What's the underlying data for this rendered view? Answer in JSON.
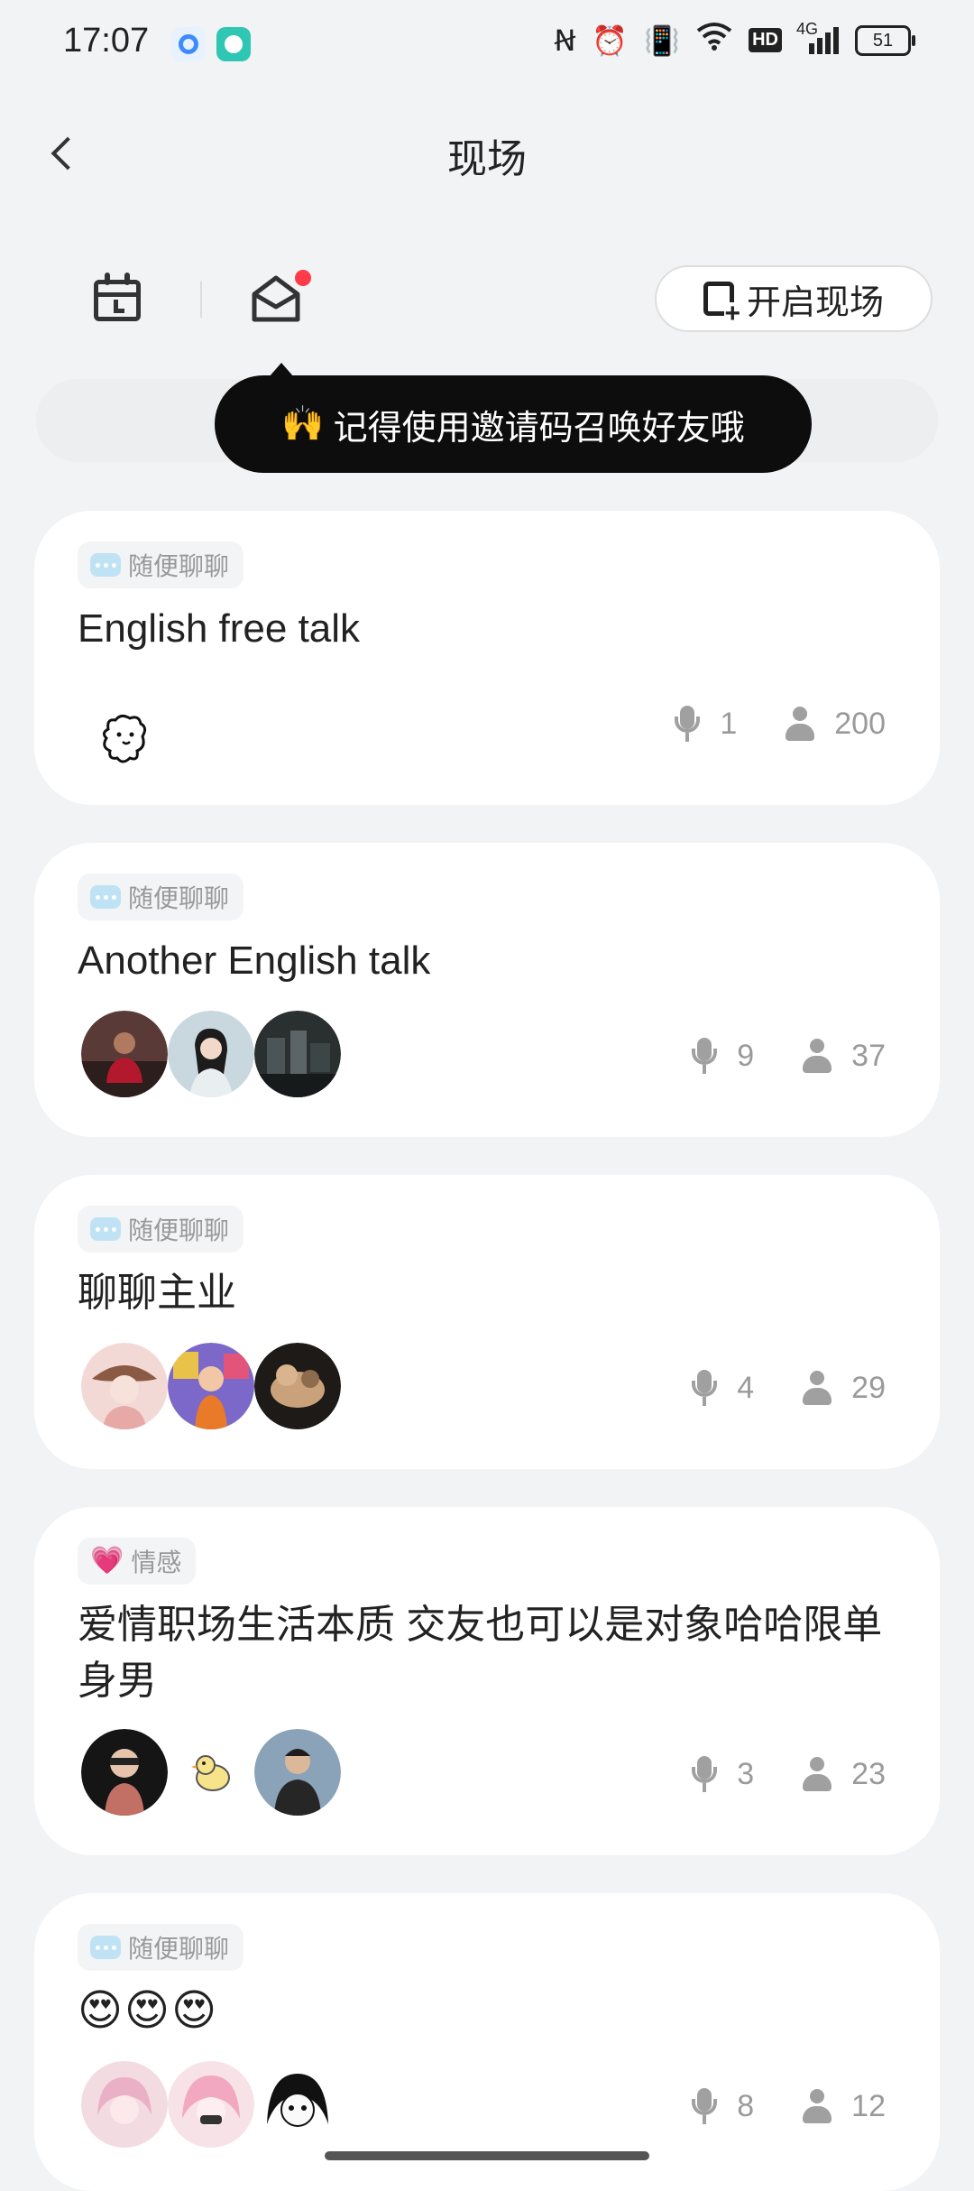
{
  "status_bar": {
    "time": "17:07",
    "battery": "51",
    "network": "4G",
    "hd": "HD",
    "icons": [
      "nfc-icon",
      "alarm-icon",
      "vibrate-icon",
      "wifi-icon",
      "hd-icon",
      "signal-icon",
      "battery-icon"
    ]
  },
  "header": {
    "title": "现场"
  },
  "toolbar": {
    "open_label": "开启现场",
    "has_notification": true
  },
  "tooltip": {
    "emoji": "🙌",
    "text": "记得使用邀请码召唤好友哦"
  },
  "rooms": [
    {
      "tag": "随便聊聊",
      "tag_icon": "chat-icon",
      "title": "English free talk",
      "avatars": [
        "avatar-dog-doodle"
      ],
      "mics": "1",
      "people": "200"
    },
    {
      "tag": "随便聊聊",
      "tag_icon": "chat-icon",
      "title": "Another English talk",
      "avatars": [
        "avatar-man-red",
        "avatar-woman-portrait",
        "avatar-street-dark"
      ],
      "mics": "9",
      "people": "37"
    },
    {
      "tag": "随便聊聊",
      "tag_icon": "chat-icon",
      "title": "聊聊主业",
      "avatars": [
        "avatar-girl-hat",
        "avatar-anime-colorful",
        "avatar-dog-photo"
      ],
      "mics": "4",
      "people": "29"
    },
    {
      "tag": "情感",
      "tag_icon": "heart-icon",
      "title": "爱情职场生活本质 交友也可以是对象哈哈限单身男",
      "avatars": [
        "avatar-woman-sunglasses",
        "avatar-duck",
        "avatar-man-suit"
      ],
      "mics": "3",
      "people": "23"
    },
    {
      "tag": "随便聊聊",
      "tag_icon": "chat-icon",
      "title": "😍😍😍",
      "avatars": [
        "avatar-pink-anime",
        "avatar-pink-anime-2",
        "avatar-manga-bw"
      ],
      "mics": "8",
      "people": "12"
    }
  ]
}
